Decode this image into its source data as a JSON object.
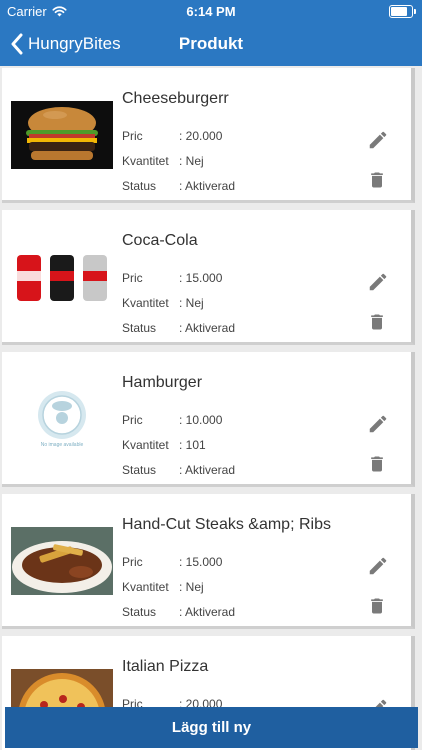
{
  "status_bar": {
    "carrier": "Carrier",
    "time": "6:14 PM",
    "battery_level": 0.9
  },
  "nav": {
    "back_label": "HungryBites",
    "title": "Produkt"
  },
  "labels": {
    "price": "Pric",
    "quantity": "Kvantitet",
    "status": "Status"
  },
  "products": [
    {
      "name": "Cheeseburgerr",
      "price": ": 20.000",
      "quantity": ": Nej",
      "status": ": Aktiverad",
      "image": "cheeseburger-photo"
    },
    {
      "name": "Coca-Cola",
      "price": ": 15.000",
      "quantity": ": Nej",
      "status": ": Aktiverad",
      "image": "coca-cola-cans-photo"
    },
    {
      "name": "Hamburger",
      "price": ": 10.000",
      "quantity": ": 101",
      "status": ": Aktiverad",
      "image": "no-image-placeholder",
      "image_caption": "No image available"
    },
    {
      "name": "Hand-Cut Steaks &amp; Ribs",
      "price": ": 15.000",
      "quantity": ": Nej",
      "status": ": Aktiverad",
      "image": "steak-ribs-photo"
    },
    {
      "name": "Italian Pizza",
      "price": ": 20.000",
      "quantity": "",
      "status": "",
      "image": "pizza-photo"
    }
  ],
  "add_button": "Lägg till ny",
  "colors": {
    "header": "#2b78c2",
    "add_button": "#1f5fa0",
    "icons": "#7a7a7a"
  }
}
